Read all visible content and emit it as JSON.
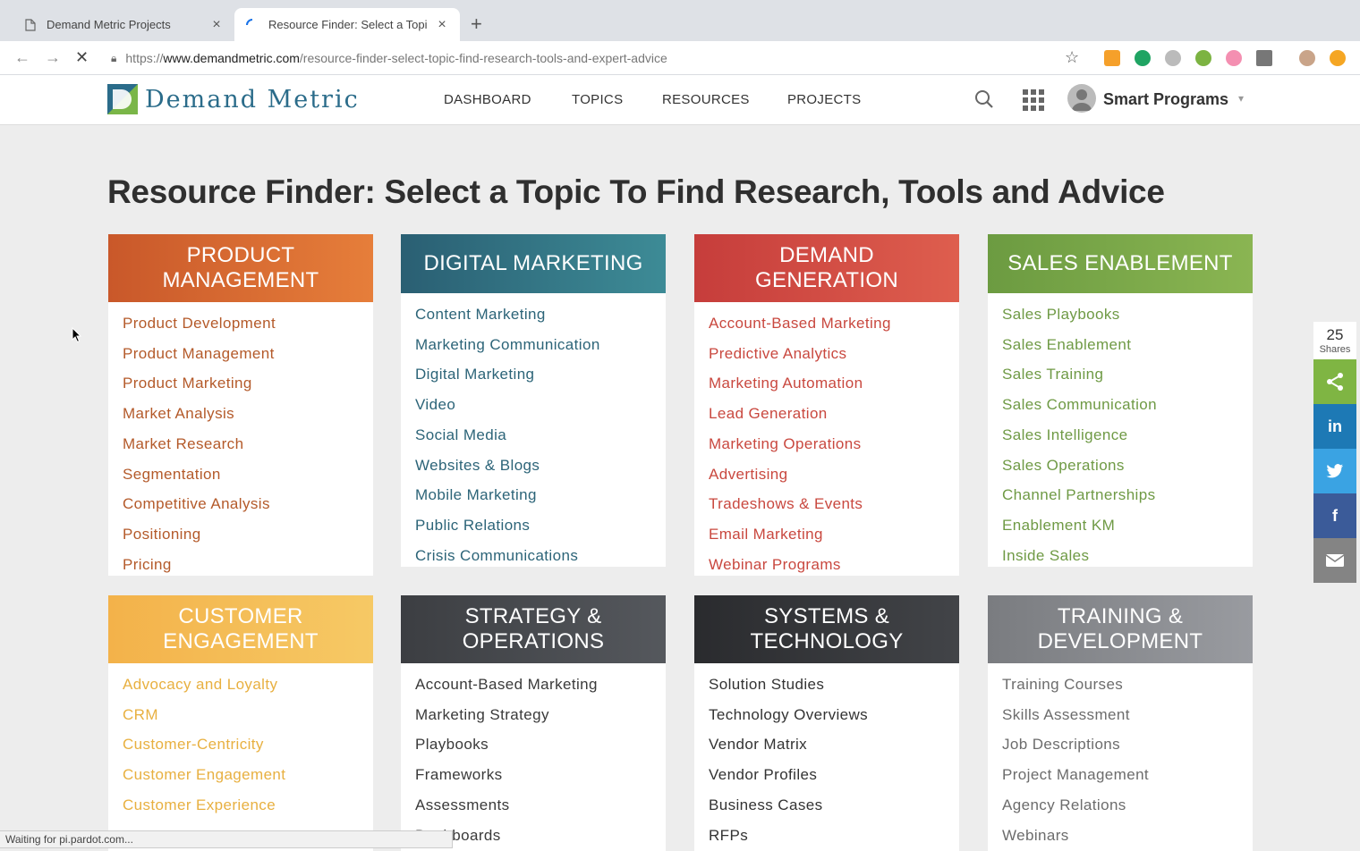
{
  "browser": {
    "tabs": [
      {
        "title": "Demand Metric Projects",
        "active": false
      },
      {
        "title": "Resource Finder: Select a Topi",
        "active": true
      }
    ],
    "url_prefix": "https://",
    "url_host": "www.demandmetric.com",
    "url_path": "/resource-finder-select-topic-find-research-tools-and-expert-advice",
    "status_text": "Waiting for pi.pardot.com..."
  },
  "site": {
    "logo_text": "Demand Metric",
    "nav": [
      "DASHBOARD",
      "TOPICS",
      "RESOURCES",
      "PROJECTS"
    ],
    "user_name": "Smart Programs"
  },
  "page_title": "Resource Finder: Select a Topic To Find Research, Tools and Advice",
  "categories": [
    {
      "title": "PRODUCT MANAGEMENT",
      "title_lines": [
        "PRODUCT",
        "MANAGEMENT"
      ],
      "items": [
        "Product Development",
        "Product Management",
        "Product Marketing",
        "Market Analysis",
        "Market Research",
        "Segmentation",
        "Competitive Analysis",
        "Positioning",
        "Pricing"
      ]
    },
    {
      "title": "DIGITAL MARKETING",
      "title_lines": [
        "DIGITAL MARKETING"
      ],
      "items": [
        "Content Marketing",
        "Marketing Communication",
        "Digital Marketing",
        "Video",
        "Social Media",
        "Websites & Blogs",
        "Mobile Marketing",
        "Public Relations",
        "Crisis Communications"
      ]
    },
    {
      "title": "DEMAND GENERATION",
      "title_lines": [
        "DEMAND",
        "GENERATION"
      ],
      "items": [
        "Account-Based Marketing",
        "Predictive Analytics",
        "Marketing Automation",
        "Lead Generation",
        "Marketing Operations",
        "Advertising",
        "Tradeshows & Events",
        "Email Marketing",
        "Webinar Programs"
      ]
    },
    {
      "title": "SALES ENABLEMENT",
      "title_lines": [
        "SALES ENABLEMENT"
      ],
      "items": [
        "Sales Playbooks",
        "Sales Enablement",
        "Sales Training",
        "Sales Communication",
        "Sales Intelligence",
        "Sales Operations",
        "Channel Partnerships",
        "Enablement KM",
        "Inside Sales"
      ]
    },
    {
      "title": "CUSTOMER ENGAGEMENT",
      "title_lines": [
        "CUSTOMER",
        "ENGAGEMENT"
      ],
      "items": [
        "Advocacy and Loyalty",
        "CRM",
        "Customer-Centricity",
        "Customer Engagement",
        "Customer Experience"
      ]
    },
    {
      "title": "STRATEGY & OPERATIONS",
      "title_lines": [
        "STRATEGY &",
        "OPERATIONS"
      ],
      "items": [
        "Account-Based Marketing",
        "Marketing Strategy",
        "Playbooks",
        "Frameworks",
        "Assessments",
        "Dashboards"
      ]
    },
    {
      "title": "SYSTEMS & TECHNOLOGY",
      "title_lines": [
        "SYSTEMS &",
        "TECHNOLOGY"
      ],
      "items": [
        "Solution Studies",
        "Technology Overviews",
        "Vendor Matrix",
        "Vendor Profiles",
        "Business Cases",
        "RFPs"
      ]
    },
    {
      "title": "TRAINING & DEVELOPMENT",
      "title_lines": [
        "TRAINING &",
        "DEVELOPMENT"
      ],
      "items": [
        "Training Courses",
        "Skills Assessment",
        "Job Descriptions",
        "Project Management",
        "Agency Relations",
        "Webinars"
      ]
    }
  ],
  "share": {
    "count": "25",
    "label": "Shares",
    "buttons": [
      {
        "name": "share",
        "color": "#7fb543"
      },
      {
        "name": "linkedin",
        "color": "#1d79b5",
        "glyph": "in"
      },
      {
        "name": "twitter",
        "color": "#3aa3e3"
      },
      {
        "name": "facebook",
        "color": "#3b5b99",
        "glyph": "f"
      },
      {
        "name": "email",
        "color": "#848484"
      }
    ]
  }
}
